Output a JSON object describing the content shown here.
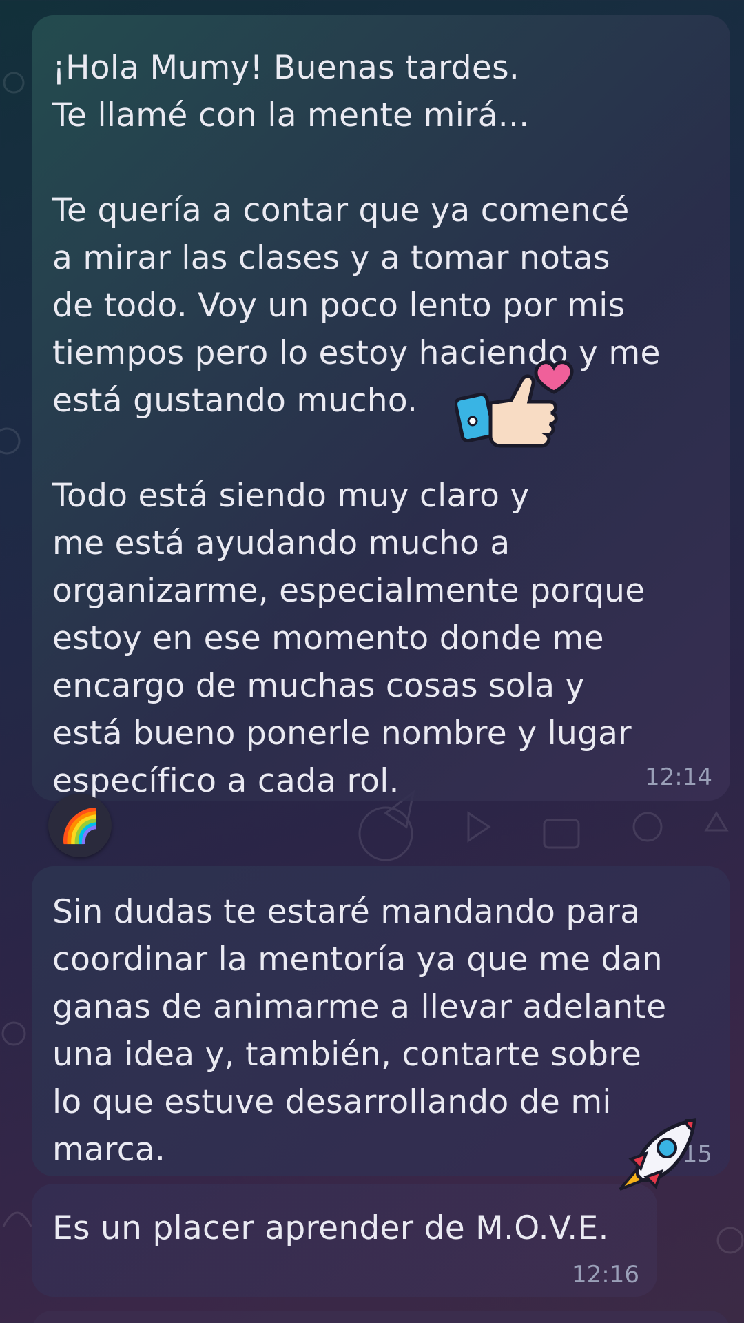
{
  "messages": [
    {
      "text": "¡Hola Mumy! Buenas tardes.\nTe llamé con la mente mirá...\n\nTe quería a contar que ya comencé\na mirar las clases y a tomar notas\nde todo. Voy un poco lento por mis\ntiempos pero lo estoy haciendo y me\nestá gustando mucho.\n\nTodo está siendo muy claro y\nme está ayudando mucho a\norganizarme, especialmente porque\nestoy en ese momento donde me\nencargo de muchas cosas sola y\nestá bueno ponerle nombre y lugar\nespecífico a cada rol.",
      "time": "12:14"
    },
    {
      "text": "Sin dudas te estaré mandando para\ncoordinar la mentoría ya que me dan\nganas de animarme a llevar adelante\nuna idea y, también, contarte sobre\nlo que estuve desarrollando de mi\nmarca.",
      "time": "12:15"
    },
    {
      "text": "Es un placer aprender de M.O.V.E.",
      "time": "12:16"
    }
  ],
  "reaction": {
    "emoji": "🌈",
    "icon": "rainbow-icon"
  },
  "stickers": [
    {
      "icon": "thumbs-up-heart-icon"
    },
    {
      "icon": "rocket-icon"
    }
  ],
  "colors": {
    "bubble_text": "#eaeaf2",
    "timestamp": "#9aa0b8",
    "heart": "#f0609a",
    "sleeve": "#39b4e4"
  }
}
